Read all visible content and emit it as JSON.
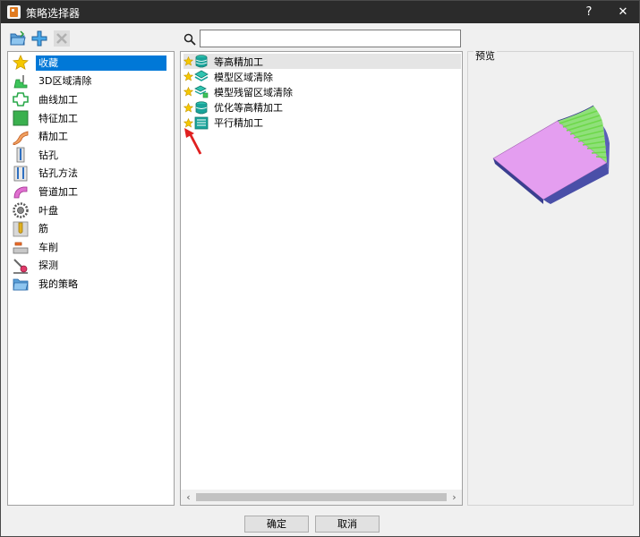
{
  "window": {
    "title": "策略选择器",
    "help_label": "?",
    "close_label": "✕"
  },
  "toolbar": {
    "icons": [
      "open-folder-icon",
      "add-icon",
      "delete-icon"
    ]
  },
  "search": {
    "value": "",
    "placeholder": ""
  },
  "categories": {
    "items": [
      {
        "label": "收藏",
        "icon": "star-icon",
        "selected": true
      },
      {
        "label": "3D区域清除",
        "icon": "area-clear-icon"
      },
      {
        "label": "曲线加工",
        "icon": "curve-machining-icon"
      },
      {
        "label": "特征加工",
        "icon": "feature-machining-icon"
      },
      {
        "label": "精加工",
        "icon": "finishing-icon"
      },
      {
        "label": "钻孔",
        "icon": "drilling-icon"
      },
      {
        "label": "钻孔方法",
        "icon": "drilling-method-icon"
      },
      {
        "label": "管道加工",
        "icon": "pipe-machining-icon"
      },
      {
        "label": "叶盘",
        "icon": "blisk-icon"
      },
      {
        "label": "筋",
        "icon": "rib-icon"
      },
      {
        "label": "车削",
        "icon": "turning-icon"
      },
      {
        "label": "探测",
        "icon": "probe-icon"
      },
      {
        "label": "我的策略",
        "icon": "folder-icon"
      }
    ]
  },
  "strategies": {
    "items": [
      {
        "label": "等高精加工",
        "icon": "constant-z-icon",
        "highlighted": true
      },
      {
        "label": "模型区域清除",
        "icon": "model-area-clear-icon"
      },
      {
        "label": "模型残留区域清除",
        "icon": "model-rest-clear-icon"
      },
      {
        "label": "优化等高精加工",
        "icon": "optimized-constant-z-icon"
      },
      {
        "label": "平行精加工",
        "icon": "raster-finishing-icon"
      }
    ]
  },
  "preview": {
    "title": "预览"
  },
  "buttons": {
    "ok": "确定",
    "cancel": "取消"
  },
  "colors": {
    "selection": "#0078d7",
    "titlebar": "#2b2b2b",
    "star": "#f0c000",
    "teal": "#1aa39a",
    "preview_face": "#e49ef0",
    "preview_side": "#4a4fa8",
    "preview_stripe": "#6ed84a",
    "annotation_arrow": "#e02020"
  }
}
